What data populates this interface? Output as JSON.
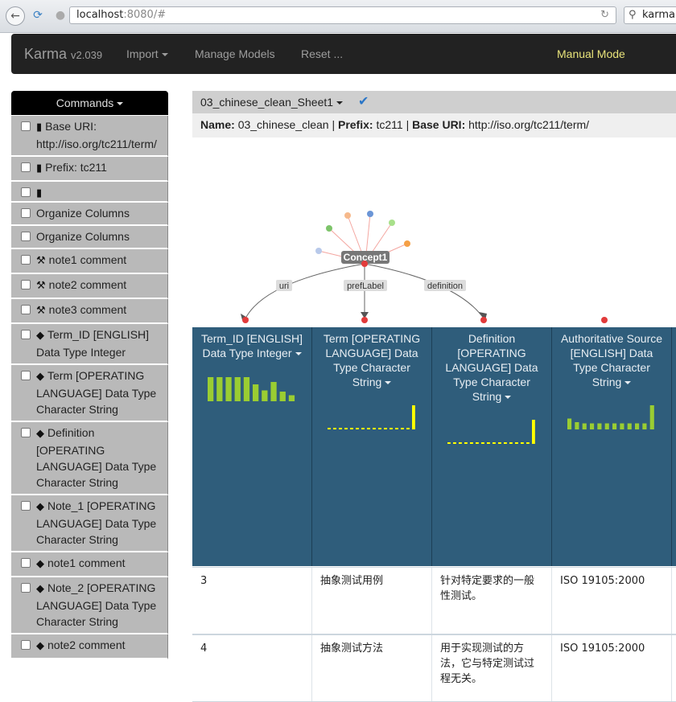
{
  "browser": {
    "url_host": "localhost",
    "url_rest": ":8080/#",
    "search_text": "karma"
  },
  "nav": {
    "brand": "Karma",
    "version": "v2.039",
    "import_label": "Import",
    "manage_label": "Manage Models",
    "reset_label": "Reset ...",
    "mode_label": "Manual Mode"
  },
  "commands": {
    "header": "Commands",
    "items": [
      {
        "icon": "file-icon",
        "label": "Base URI: http://iso.org/tc211/term/"
      },
      {
        "icon": "file-icon",
        "label": "Prefix: tc211"
      },
      {
        "icon": "file-icon",
        "label": ""
      },
      {
        "icon": "",
        "label": "Organize Columns"
      },
      {
        "icon": "",
        "label": "Organize Columns"
      },
      {
        "icon": "wrench-icon",
        "label": "note1 comment"
      },
      {
        "icon": "wrench-icon",
        "label": "note2 comment"
      },
      {
        "icon": "wrench-icon",
        "label": "note3 comment"
      },
      {
        "icon": "tags-icon",
        "label": "Term_ID [ENGLISH] Data Type Integer"
      },
      {
        "icon": "tags-icon",
        "label": "Term [OPERATING LANGUAGE] Data Type Character String"
      },
      {
        "icon": "tags-icon",
        "label": "Definition [OPERATING LANGUAGE] Data Type Character String"
      },
      {
        "icon": "tags-icon",
        "label": "Note_1 [OPERATING LANGUAGE] Data Type Character String"
      },
      {
        "icon": "tags-icon",
        "label": "note1 comment"
      },
      {
        "icon": "tags-icon",
        "label": "Note_2 [OPERATING LANGUAGE] Data Type Character String"
      },
      {
        "icon": "tags-icon",
        "label": "note2 comment"
      }
    ]
  },
  "worksheet": {
    "title": "03_chinese_clean_Sheet1",
    "name_label": "Name:",
    "name_value": "03_chinese_clean",
    "prefix_label": "Prefix:",
    "prefix_value": "tc211",
    "baseuri_label": "Base URI:",
    "baseuri_value": "http://iso.org/tc211/term/",
    "sep": "|"
  },
  "graph": {
    "node_label": "Concept1",
    "edges": [
      "uri",
      "prefLabel",
      "definition"
    ]
  },
  "table": {
    "columns": [
      {
        "header": "Term_ID [ENGLISH] Data Type Integer",
        "bars": [
          1,
          1,
          1,
          1,
          1,
          0.7,
          0.45,
          0.8,
          0.4,
          0.25
        ],
        "bar_color": "#9acd32"
      },
      {
        "header": "Term [OPERATING LANGUAGE] Data Type Character String",
        "bars": [
          0.05,
          0.05,
          0.05,
          0.05,
          0.05,
          0.05,
          0.05,
          0.05,
          0.05,
          0.05,
          0.05,
          0.05,
          0.05,
          0.05,
          0.05,
          1
        ],
        "bar_color": "#ffff00"
      },
      {
        "header": "Definition [OPERATING LANGUAGE] Data Type Character String",
        "bars": [
          0.05,
          0.05,
          0.05,
          0.05,
          0.05,
          0.05,
          0.05,
          0.05,
          0.05,
          0.05,
          0.05,
          0.05,
          0.05,
          0.05,
          0.05,
          1
        ],
        "bar_color": "#ffff00"
      },
      {
        "header": "Authoritative Source [ENGLISH] Data Type Character String",
        "bars": [
          0.45,
          0.3,
          0.25,
          0.25,
          0.25,
          0.25,
          0.25,
          0.25,
          0.25,
          0.25,
          0.25,
          1
        ],
        "bar_color": "#9acd32"
      }
    ],
    "rows": [
      [
        "3",
        "抽象测试用例",
        "针对特定要求的一般性测试。",
        "ISO 19105:2000"
      ],
      [
        "4",
        "抽象测试方法",
        "用于实现测试的方法，它与特定测试过程无关。",
        "ISO 19105:2000"
      ]
    ]
  }
}
